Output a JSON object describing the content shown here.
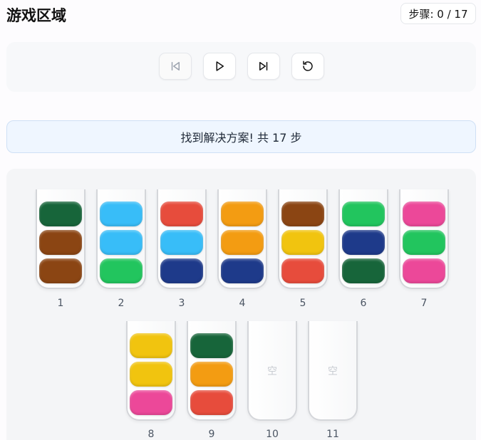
{
  "header": {
    "title": "游戏区域",
    "steps": "步骤: 0 / 17"
  },
  "controls": [
    {
      "name": "first-step-button",
      "icon": "skip-back-icon",
      "disabled": true
    },
    {
      "name": "play-button",
      "icon": "play-icon",
      "disabled": false
    },
    {
      "name": "next-step-button",
      "icon": "skip-forward-icon",
      "disabled": false
    },
    {
      "name": "reset-button",
      "icon": "reset-icon",
      "disabled": false
    }
  ],
  "banner": {
    "text": "找到解决方案! 共 17 步"
  },
  "colors": {
    "dark_green": "#17653a",
    "brown": "#8b4513",
    "sky_blue": "#38bdf8",
    "green": "#22c55e",
    "red": "#e74c3c",
    "navy": "#1e3a8a",
    "orange": "#f39c12",
    "yellow": "#f1c40f",
    "pink": "#ec4899"
  },
  "tubes": [
    {
      "label": "1",
      "balls": [
        "dark_green",
        "brown",
        "brown"
      ]
    },
    {
      "label": "2",
      "balls": [
        "sky_blue",
        "sky_blue",
        "green"
      ]
    },
    {
      "label": "3",
      "balls": [
        "red",
        "sky_blue",
        "navy"
      ]
    },
    {
      "label": "4",
      "balls": [
        "orange",
        "orange",
        "navy"
      ]
    },
    {
      "label": "5",
      "balls": [
        "brown",
        "yellow",
        "red"
      ]
    },
    {
      "label": "6",
      "balls": [
        "green",
        "navy",
        "dark_green"
      ]
    },
    {
      "label": "7",
      "balls": [
        "pink",
        "green",
        "pink"
      ]
    },
    {
      "label": "8",
      "balls": [
        "yellow",
        "yellow",
        "pink"
      ]
    },
    {
      "label": "9",
      "balls": [
        "dark_green",
        "orange",
        "red"
      ]
    },
    {
      "label": "10",
      "balls": [],
      "empty_text": "空"
    },
    {
      "label": "11",
      "balls": [],
      "empty_text": "空"
    }
  ]
}
